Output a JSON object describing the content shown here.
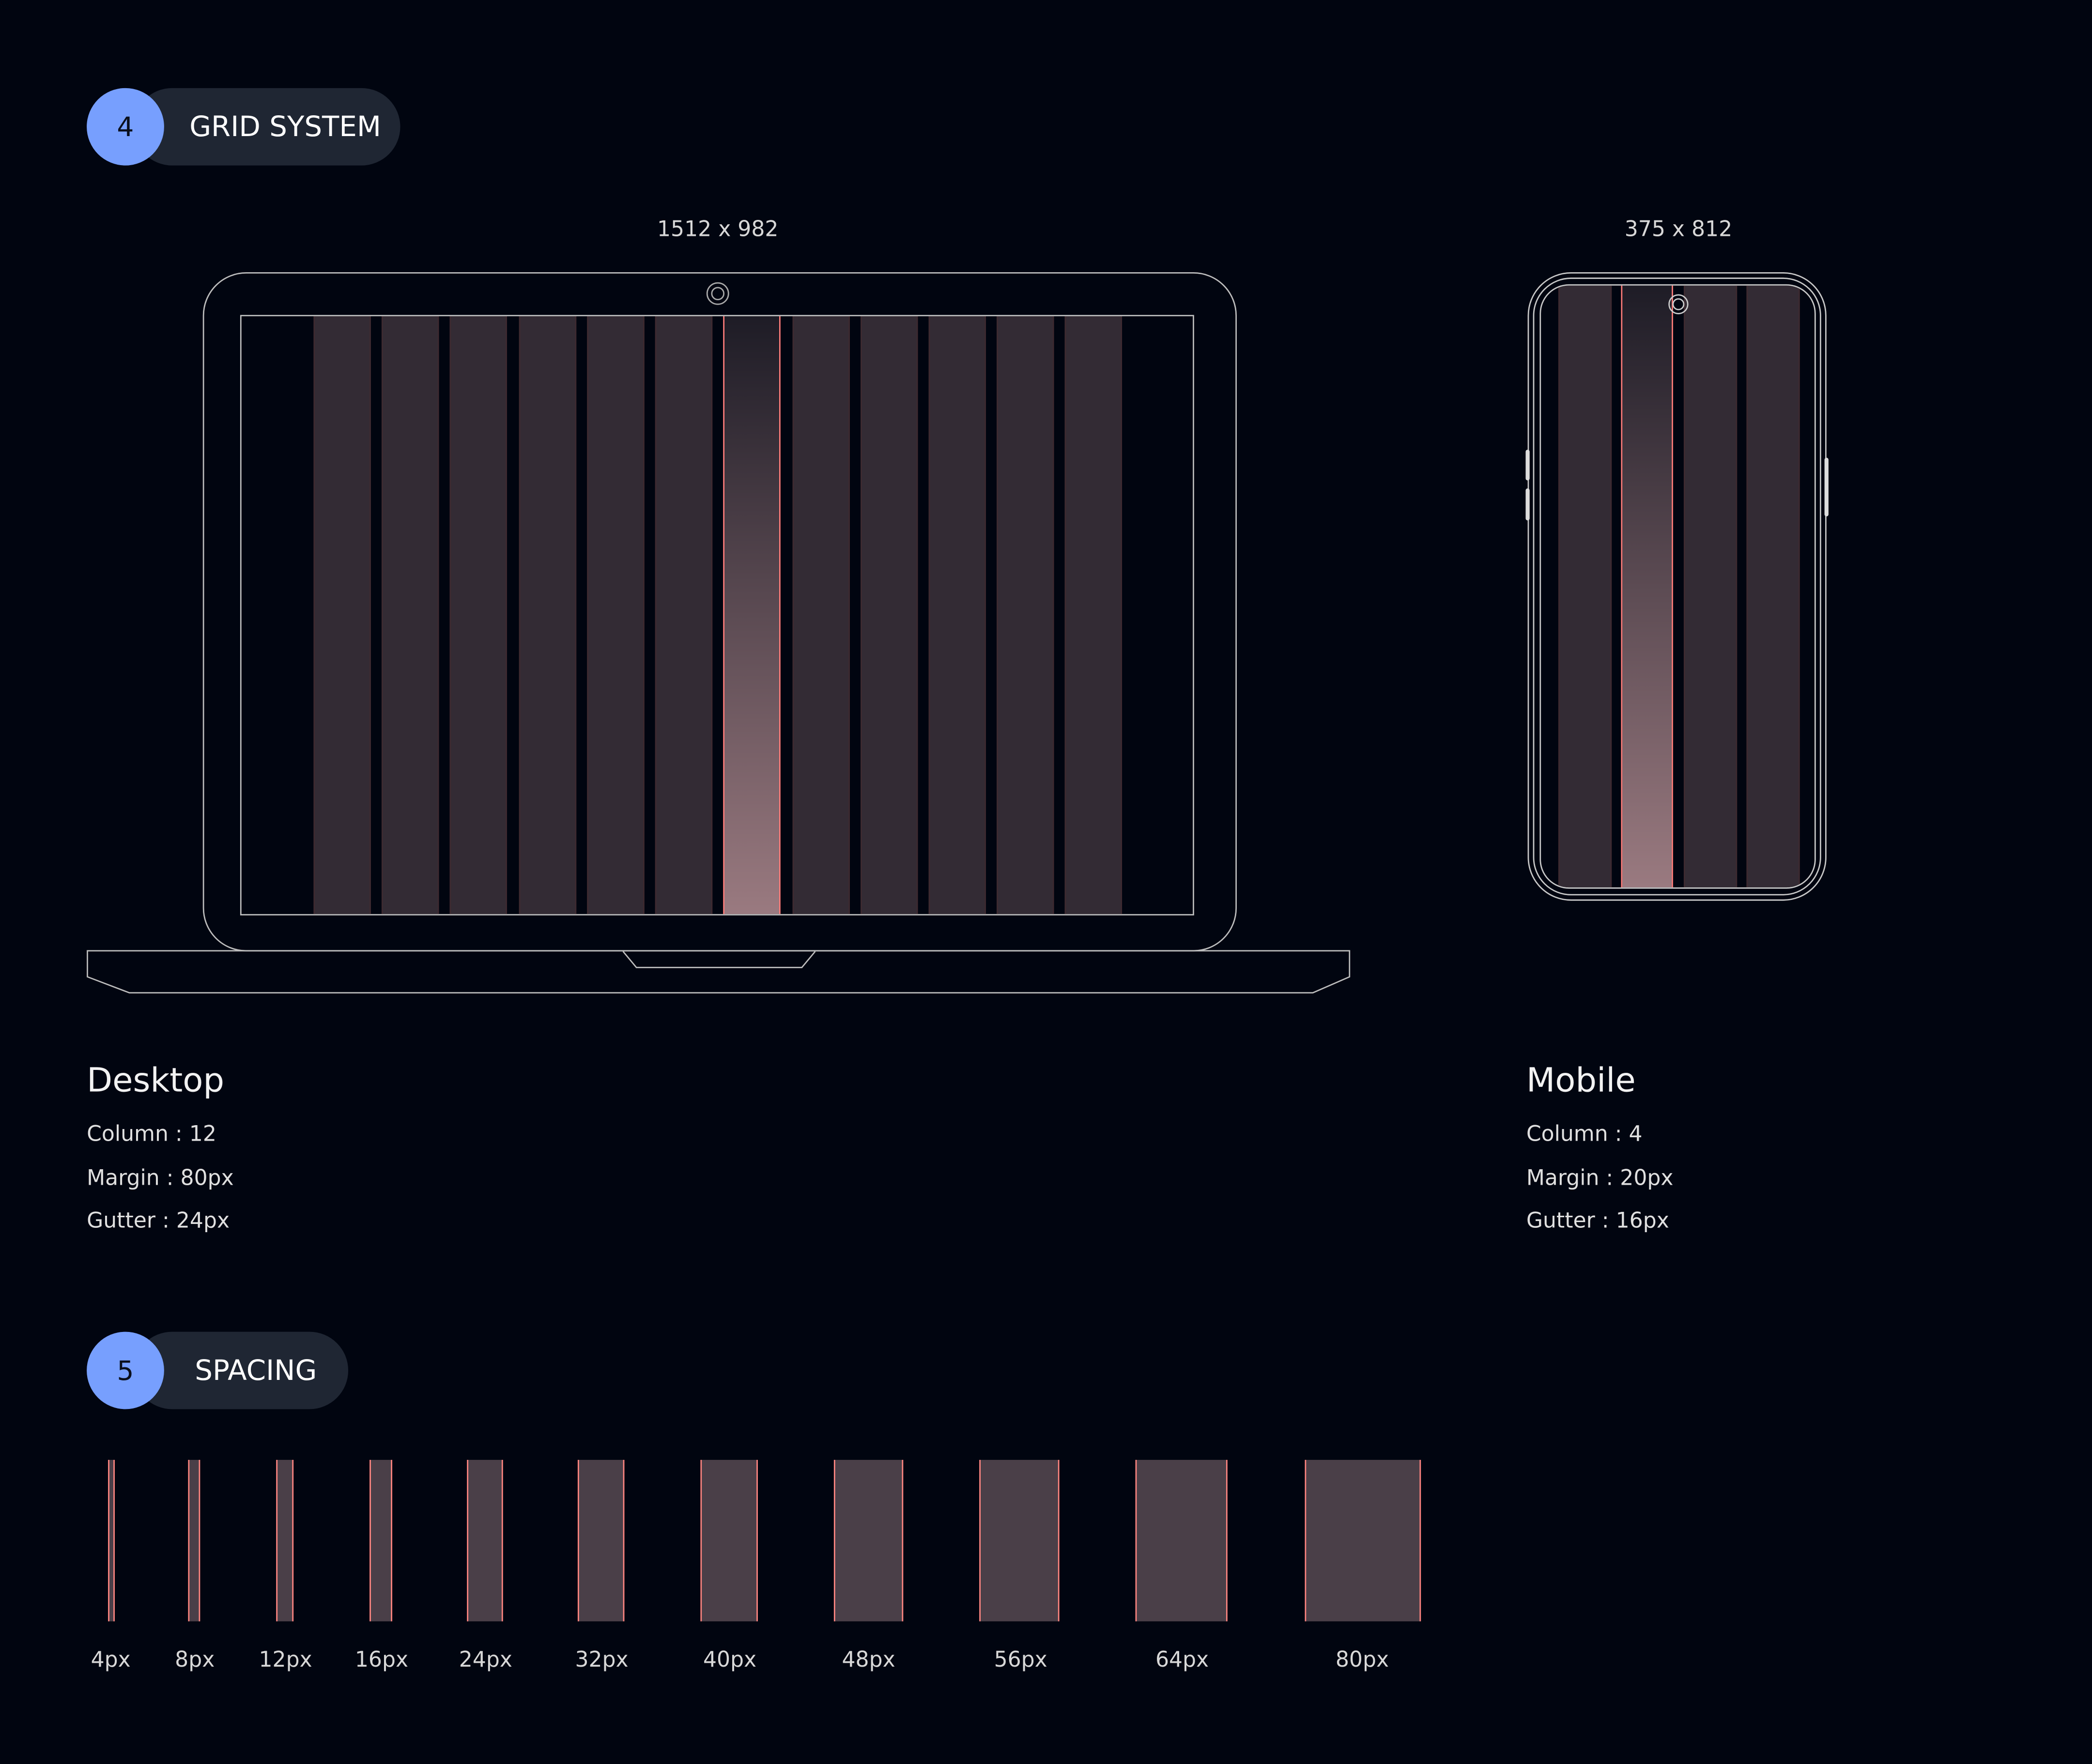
{
  "sections": {
    "grid": {
      "number": "4",
      "title": "GRID SYSTEM"
    },
    "spacing": {
      "number": "5",
      "title": "SPACING"
    }
  },
  "desktop": {
    "dimensions": "1512 x 982",
    "title": "Desktop",
    "column": "Column : 12",
    "margin": "Margin : 80px",
    "gutter": "Gutter : 24px"
  },
  "mobile": {
    "dimensions": "375 x 812",
    "title": "Mobile",
    "column": "Column : 4",
    "margin": "Margin : 20px",
    "gutter": "Gutter : 16px"
  },
  "spacing_scale": [
    "4px",
    "8px",
    "12px",
    "16px",
    "24px",
    "32px",
    "40px",
    "48px",
    "56px",
    "64px",
    "80px"
  ],
  "colors": {
    "accent": "#779ffe",
    "pill": "#1f2633",
    "guide": "#ff7d7a",
    "background": "#010510"
  }
}
